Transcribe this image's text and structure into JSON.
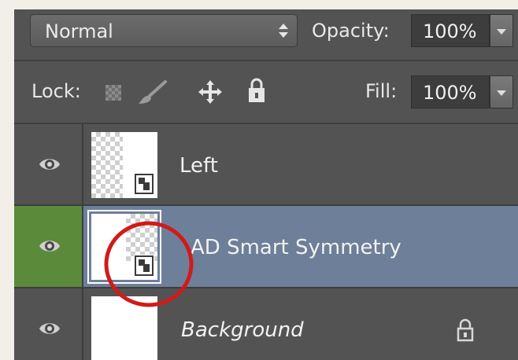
{
  "blend_mode": {
    "value": "Normal",
    "stepper_icon": "up-down-arrows-icon"
  },
  "opacity": {
    "label": "Opacity:",
    "value": "100%"
  },
  "lock": {
    "label": "Lock:",
    "icons": [
      "lock-transparent-pixels-icon",
      "lock-image-pixels-icon",
      "lock-position-icon",
      "lock-all-icon"
    ]
  },
  "fill": {
    "label": "Fill:",
    "value": "100%"
  },
  "layers": [
    {
      "name": "Left",
      "visible": true,
      "selected": false,
      "type": "smart-object",
      "locked": false
    },
    {
      "name": "AD Smart Symmetry",
      "visible": true,
      "selected": true,
      "type": "smart-object",
      "locked": false,
      "highlighted_by_annotation": true
    },
    {
      "name": "Background",
      "visible": true,
      "selected": false,
      "type": "background",
      "locked": true,
      "italic": true
    }
  ],
  "colors": {
    "panel_bg": "#535353",
    "selected_row": "#6e7f99",
    "selected_eye_cell": "#5b8a3a",
    "annotation_circle": "#d11a1a"
  }
}
